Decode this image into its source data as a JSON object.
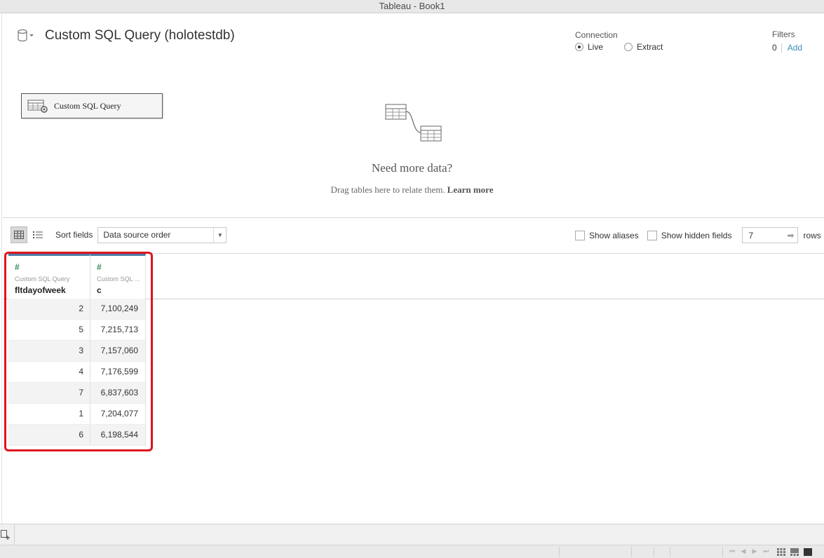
{
  "window": {
    "title": "Tableau - Book1"
  },
  "datasource": {
    "title": "Custom SQL Query (holotestdb)"
  },
  "connection": {
    "label": "Connection",
    "live": "Live",
    "extract": "Extract",
    "selected": "Live"
  },
  "filters": {
    "label": "Filters",
    "count": "0",
    "add": "Add"
  },
  "canvas": {
    "table_label": "Custom SQL Query",
    "need_title": "Need more data?",
    "need_sub": "Drag tables here to relate them.",
    "learn_more": "Learn more"
  },
  "toolbar": {
    "sort_label": "Sort fields",
    "sort_value": "Data source order",
    "show_aliases": "Show aliases",
    "show_hidden": "Show hidden fields",
    "rows_value": "7",
    "rows_label": "rows"
  },
  "grid": {
    "columns": [
      {
        "type_icon": "#",
        "source": "Custom SQL Query",
        "name": "fltdayofweek"
      },
      {
        "type_icon": "#",
        "source": "Custom SQL ...",
        "name": "c"
      }
    ],
    "rows": [
      [
        "2",
        "7,100,249"
      ],
      [
        "5",
        "7,215,713"
      ],
      [
        "3",
        "7,157,060"
      ],
      [
        "4",
        "7,176,599"
      ],
      [
        "7",
        "6,837,603"
      ],
      [
        "1",
        "7,204,077"
      ],
      [
        "6",
        "6,198,544"
      ]
    ]
  },
  "colors": {
    "accent": "#3a8fb5",
    "highlight": "#e0141c",
    "header_bar": "#4b79a6",
    "measure_icon": "#2d8a5b"
  }
}
